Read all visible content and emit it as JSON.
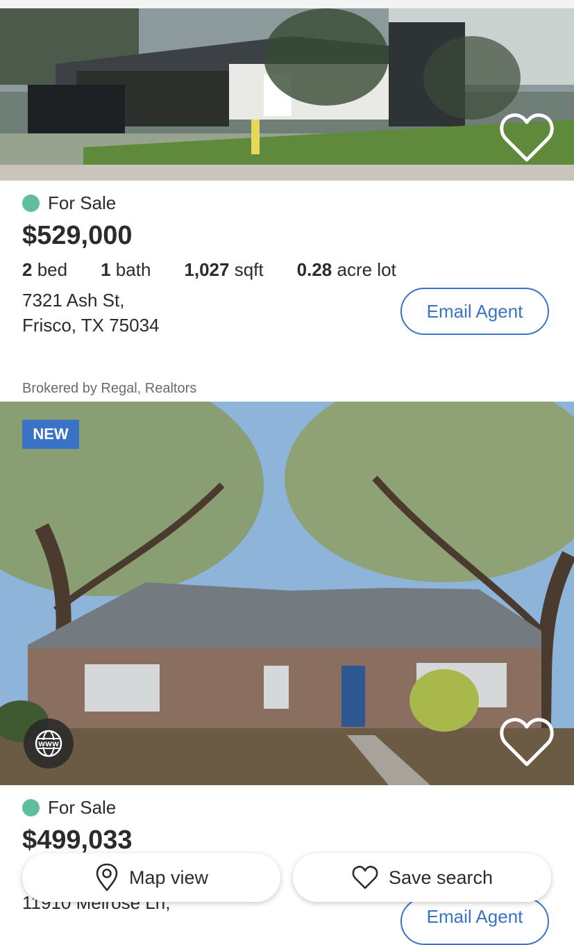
{
  "listings": [
    {
      "status": "For Sale",
      "price": "$529,000",
      "beds_num": "2",
      "beds_unit": "bed",
      "baths_num": "1",
      "baths_unit": "bath",
      "sqft_num": "1,027",
      "sqft_unit": "sqft",
      "lot_num": "0.28",
      "lot_unit": "acre lot",
      "address_line1": "7321 Ash St,",
      "address_line2": "Frisco, TX 75034",
      "email_label": "Email Agent",
      "broker": "Brokered by Regal, Realtors"
    },
    {
      "badge": "NEW",
      "status": "For Sale",
      "price": "$499,033",
      "address_line1": "11910 Melrose Ln,",
      "email_label": "Email Agent"
    }
  ],
  "bottom_bar": {
    "map_label": "Map view",
    "save_label": "Save search"
  },
  "colors": {
    "accent": "#3a72c6",
    "status_dot": "#5fbf9b"
  },
  "icons": [
    "heart-icon",
    "globe-www-icon",
    "map-pin-icon",
    "heart-outline-icon"
  ]
}
